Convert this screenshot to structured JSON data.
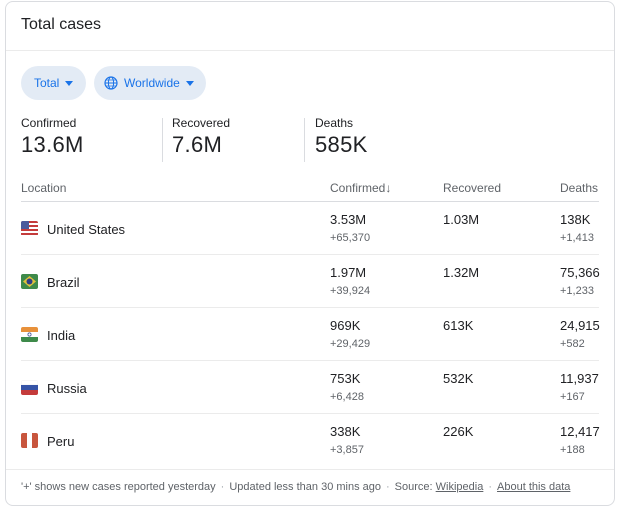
{
  "title": "Total cases",
  "filters": {
    "type_label": "Total",
    "region_label": "Worldwide"
  },
  "summary": {
    "confirmed_label": "Confirmed",
    "confirmed_value": "13.6M",
    "recovered_label": "Recovered",
    "recovered_value": "7.6M",
    "deaths_label": "Deaths",
    "deaths_value": "585K"
  },
  "table": {
    "headers": {
      "location": "Location",
      "confirmed": "Confirmed",
      "recovered": "Recovered",
      "deaths": "Deaths"
    },
    "rows": [
      {
        "country": "United States",
        "confirmed": "3.53M",
        "confirmed_new": "+65,370",
        "recovered": "1.03M",
        "deaths": "138K",
        "deaths_new": "+1,413",
        "flag_icon": "us-flag-icon"
      },
      {
        "country": "Brazil",
        "confirmed": "1.97M",
        "confirmed_new": "+39,924",
        "recovered": "1.32M",
        "deaths": "75,366",
        "deaths_new": "+1,233",
        "flag_icon": "brazil-flag-icon"
      },
      {
        "country": "India",
        "confirmed": "969K",
        "confirmed_new": "+29,429",
        "recovered": "613K",
        "deaths": "24,915",
        "deaths_new": "+582",
        "flag_icon": "india-flag-icon"
      },
      {
        "country": "Russia",
        "confirmed": "753K",
        "confirmed_new": "+6,428",
        "recovered": "532K",
        "deaths": "11,937",
        "deaths_new": "+167",
        "flag_icon": "russia-flag-icon"
      },
      {
        "country": "Peru",
        "confirmed": "338K",
        "confirmed_new": "+3,857",
        "recovered": "226K",
        "deaths": "12,417",
        "deaths_new": "+188",
        "flag_icon": "peru-flag-icon"
      }
    ]
  },
  "footer": {
    "note": "'+' shows new cases reported yesterday",
    "updated": "Updated less than 30 mins ago",
    "source_label": "Source:",
    "source_link": "Wikipedia",
    "about_link": "About this data"
  },
  "colors": {
    "accent": "#1a73e8",
    "chip_bg": "#e3ebf5"
  }
}
